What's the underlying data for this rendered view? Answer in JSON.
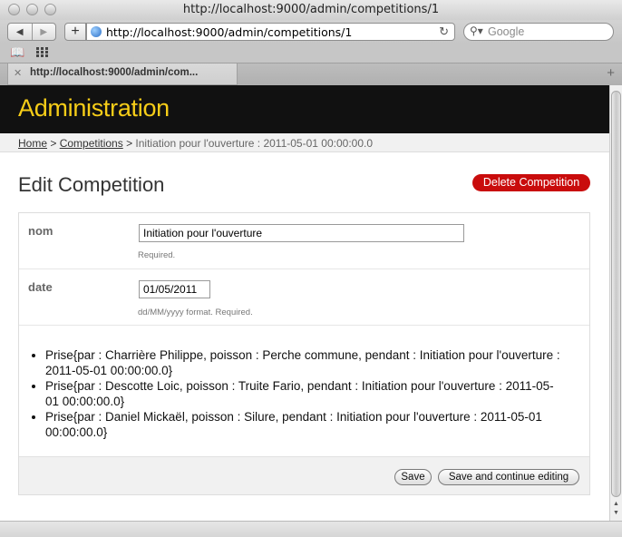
{
  "window": {
    "title": "http://localhost:9000/admin/competitions/1"
  },
  "toolbar": {
    "url": "http://localhost:9000/admin/competitions/1",
    "search_placeholder": "Google",
    "back_icon": "back-arrow-icon",
    "forward_icon": "forward-arrow-icon",
    "reload_icon": "reload-icon"
  },
  "tabs": [
    {
      "label": "http://localhost:9000/admin/com..."
    }
  ],
  "header": {
    "brand": "Administration",
    "brand_color": "#f6cd18"
  },
  "breadcrumb": {
    "home": "Home",
    "sep1": " > ",
    "competitions": "Competitions",
    "sep2": " > ",
    "current": "Initiation pour l'ouverture : 2011-05-01 00:00:00.0"
  },
  "page": {
    "title": "Edit Competition",
    "delete_label": "Delete Competition",
    "delete_color": "#c90c0c"
  },
  "form": {
    "fields": [
      {
        "label": "nom",
        "value": "Initiation pour l'ouverture",
        "help": "Required."
      },
      {
        "label": "date",
        "value": "01/05/2011",
        "help": "dd/MM/yyyy format. Required."
      }
    ],
    "prises": [
      "Prise{par : Charrière Philippe, poisson : Perche commune, pendant : Initiation pour l'ouverture : 2011-05-01 00:00:00.0}",
      "Prise{par : Descotte Loic, poisson : Truite Fario, pendant : Initiation pour l'ouverture : 2011-05-01 00:00:00.0}",
      "Prise{par : Daniel Mickaël, poisson : Silure, pendant : Initiation pour l'ouverture : 2011-05-01 00:00:00.0}"
    ],
    "save_label": "Save",
    "save_continue_label": "Save and continue editing"
  }
}
